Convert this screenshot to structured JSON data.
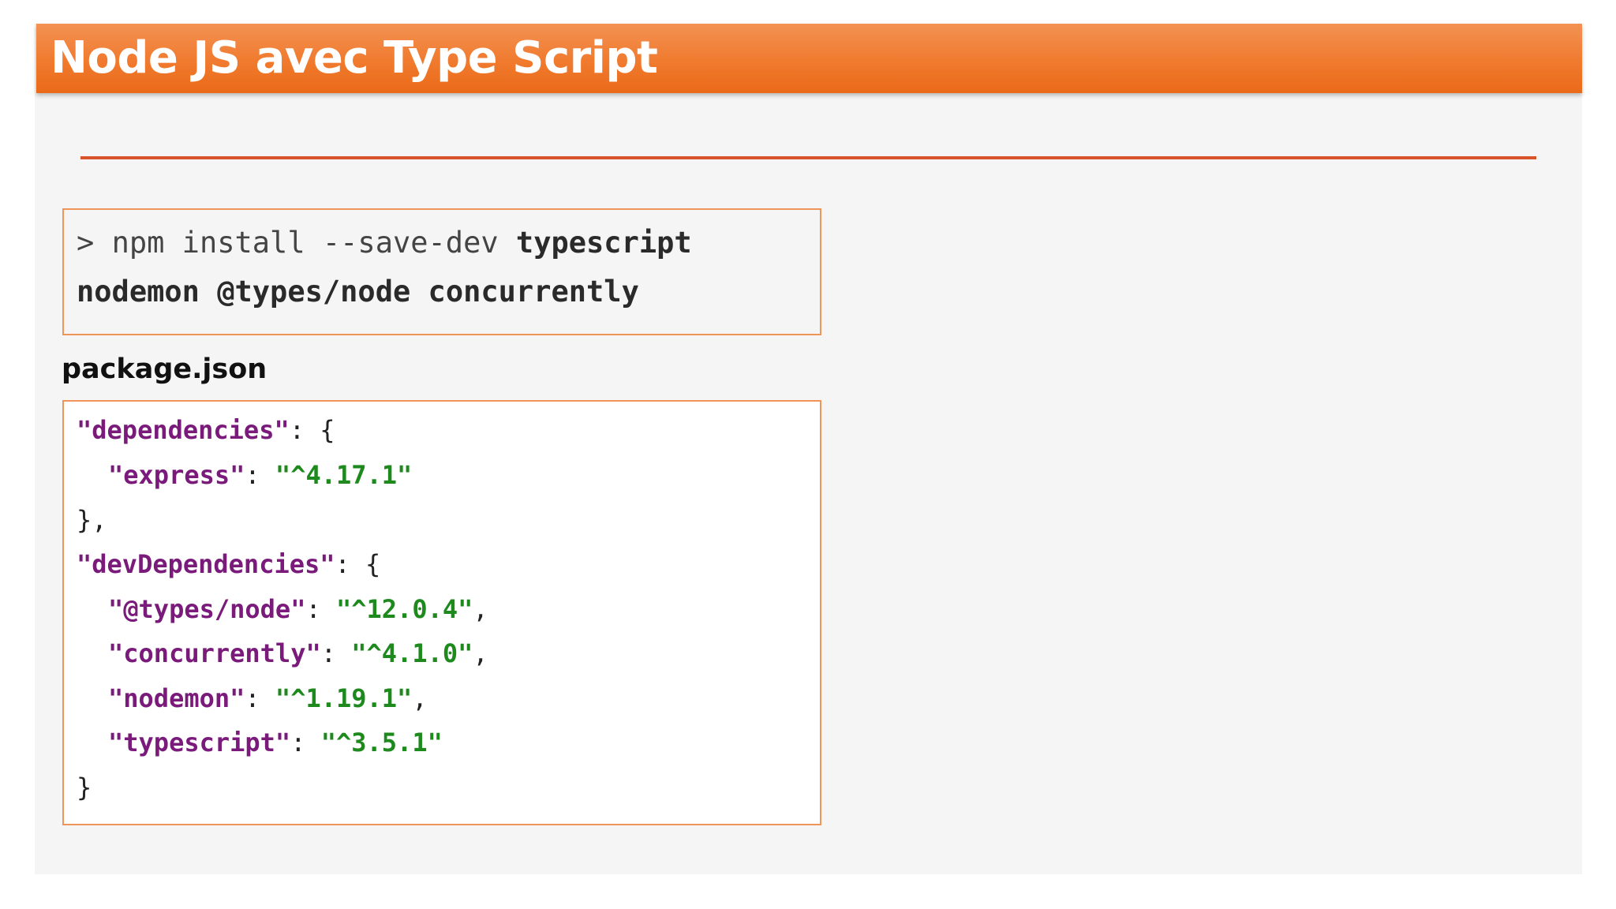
{
  "slide": {
    "title": "Node JS avec Type Script",
    "colors": {
      "header": "#f07a2e",
      "divider": "#d9532a",
      "box_border": "#f0955a",
      "json_key": "#7a1a7a",
      "json_value": "#1e8a1e"
    }
  },
  "command": {
    "prompt": ">",
    "base": "npm install --save-dev",
    "pkg_1": "typescript",
    "pkg_2": "nodemon",
    "pkg_3": "@types/node",
    "pkg_4": "concurrently"
  },
  "package_json": {
    "label": "package.json",
    "dependencies_key": "\"dependencies\"",
    "dependencies": [
      {
        "name": "\"express\"",
        "version": "\"^4.17.1\"",
        "comma": ""
      }
    ],
    "dev_dependencies_key": "\"devDependencies\"",
    "dev_dependencies": [
      {
        "name": "\"@types/node\"",
        "version": "\"^12.0.4\"",
        "comma": ","
      },
      {
        "name": "\"concurrently\"",
        "version": "\"^4.1.0\"",
        "comma": ","
      },
      {
        "name": "\"nodemon\"",
        "version": "\"^1.19.1\"",
        "comma": ","
      },
      {
        "name": "\"typescript\"",
        "version": "\"^3.5.1\"",
        "comma": ""
      }
    ],
    "open_brace": ": {",
    "close_brace_comma": "},",
    "close_brace": "}",
    "colon": ": "
  }
}
